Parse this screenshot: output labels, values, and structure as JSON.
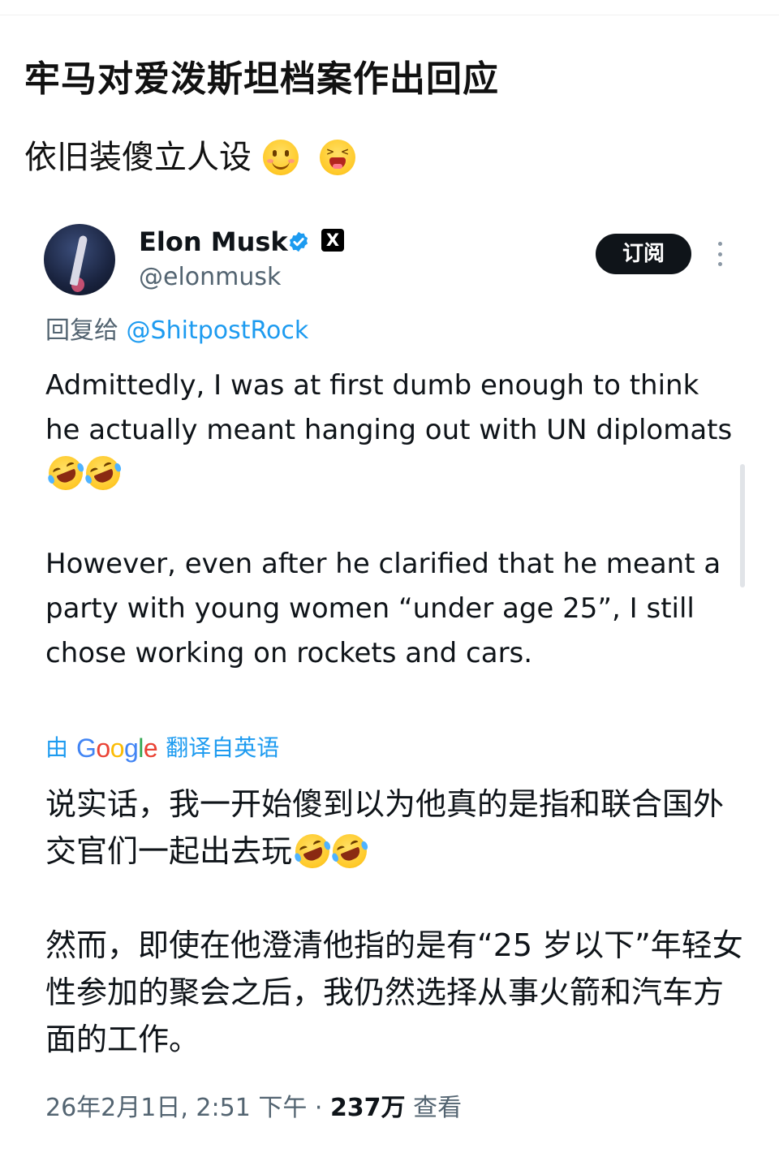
{
  "post": {
    "title": "牢马对爱泼斯坦档案作出回应",
    "body_text": "依旧装傻立人设",
    "emojis": [
      "smiling-face-icon",
      "laughing-face-icon"
    ]
  },
  "tweet": {
    "author_name": "Elon Musk",
    "handle": "@elonmusk",
    "subscribe_label": "订阅",
    "x_badge": "X",
    "reply_prefix": "回复给",
    "reply_mention": "@ShitpostRock",
    "paragraph_1": "Admittedly, I was at first dumb enough to think he actually meant hanging out with UN diplomats",
    "paragraph_2": "However, even after he clarified that he meant a party with young women “under age 25”, I still chose working on rockets and cars.",
    "translate_prefix": "由",
    "translate_brand": "Google",
    "translate_suffix": "翻译自英语",
    "translated_1": "说实话，我一开始傻到以为他真的是指和联合国外交官们一起出去玩",
    "translated_2": "然而，即使在他澄清他指的是有“25 岁以下”年轻女性参加的聚会之后，我仍然选择从事火箭和汽车方面的工作。",
    "timestamp": "26年2月1日, 2:51 下午 · ",
    "views_count": "237万",
    "views_label": " 查看"
  },
  "colors": {
    "link": "#1d9bf0",
    "muted": "#536471",
    "text": "#0f1419"
  }
}
